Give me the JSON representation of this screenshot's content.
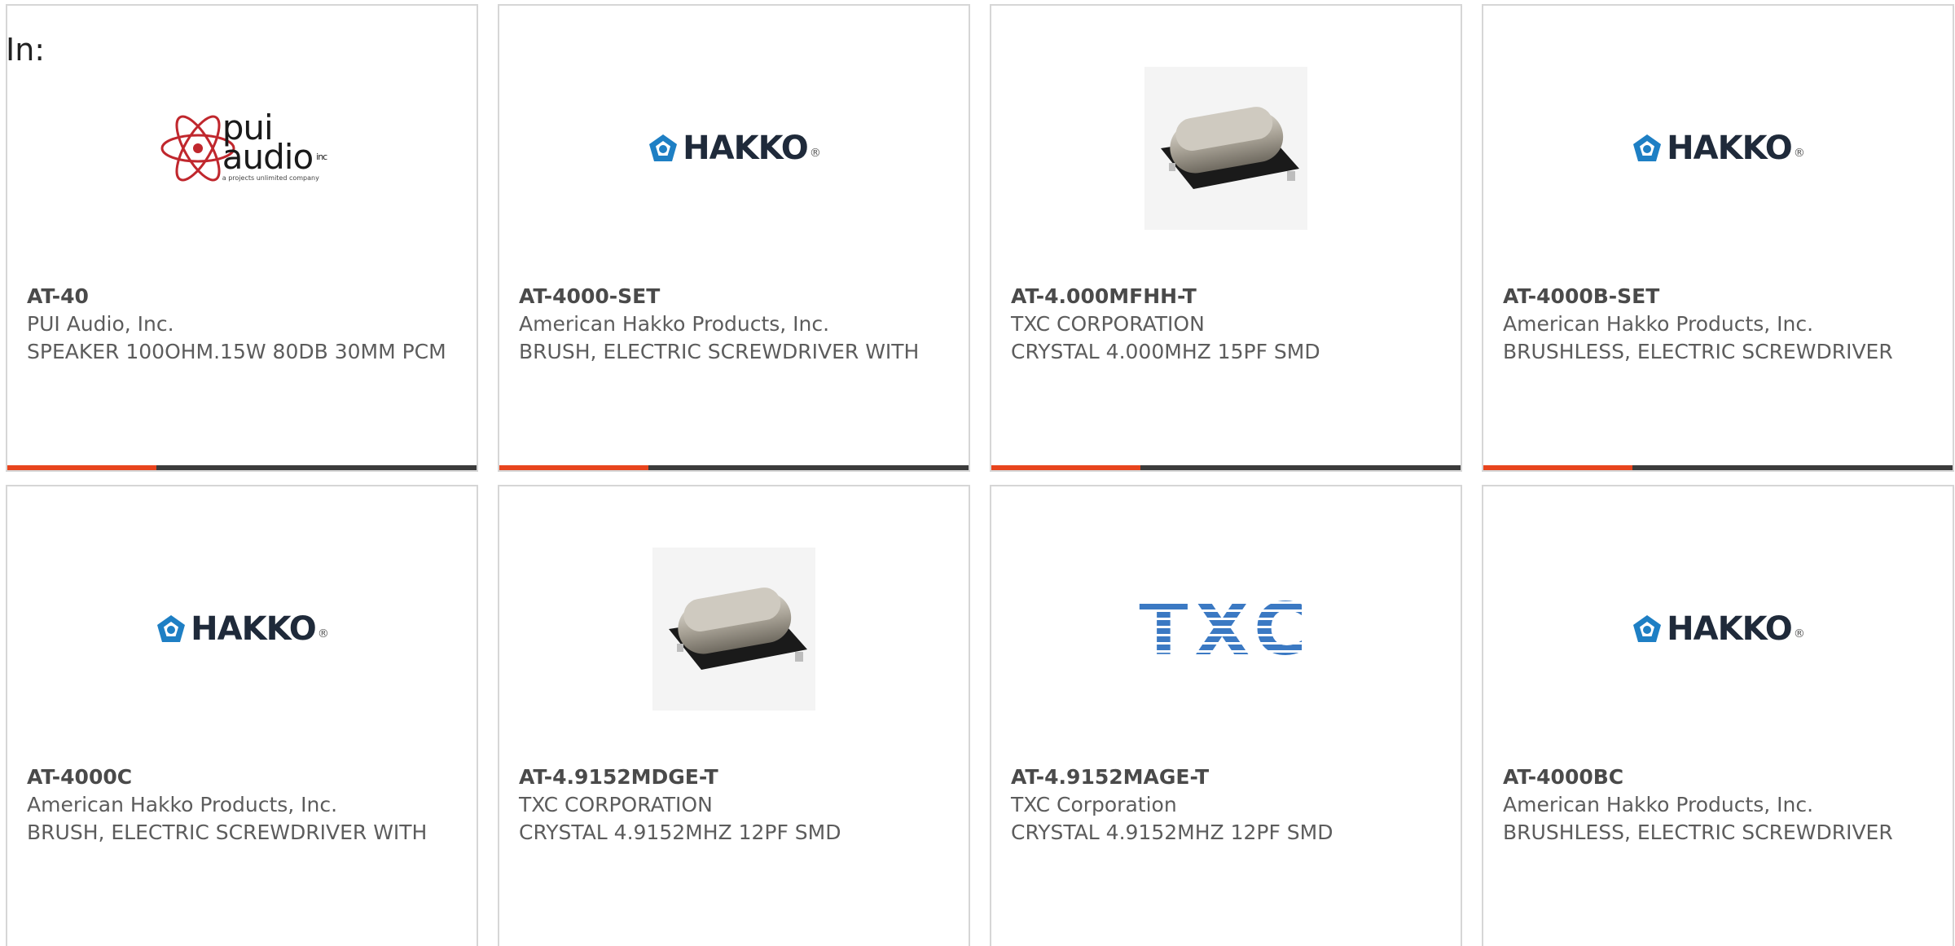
{
  "filter_label": "In:",
  "products": [
    {
      "part_number": "AT-40",
      "manufacturer": "PUI Audio, Inc.",
      "description": "SPEAKER 100OHM.15W 80DB 30MM PCM",
      "image": "pui-audio-logo"
    },
    {
      "part_number": "AT-4000-SET",
      "manufacturer": "American Hakko Products, Inc.",
      "description": "BRUSH, ELECTRIC SCREWDRIVER WITH",
      "image": "hakko-logo"
    },
    {
      "part_number": "AT-4.000MFHH-T",
      "manufacturer": "TXC CORPORATION",
      "description": "CRYSTAL 4.000MHZ 15PF SMD",
      "image": "crystal-smd-photo"
    },
    {
      "part_number": "AT-4000B-SET",
      "manufacturer": "American Hakko Products, Inc.",
      "description": "BRUSHLESS, ELECTRIC SCREWDRIVER",
      "image": "hakko-logo"
    },
    {
      "part_number": "AT-4000C",
      "manufacturer": "American Hakko Products, Inc.",
      "description": "BRUSH, ELECTRIC SCREWDRIVER WITH",
      "image": "hakko-logo"
    },
    {
      "part_number": "AT-4.9152MDGE-T",
      "manufacturer": "TXC CORPORATION",
      "description": "CRYSTAL 4.9152MHZ 12PF SMD",
      "image": "crystal-smd-photo"
    },
    {
      "part_number": "AT-4.9152MAGE-T",
      "manufacturer": "TXC Corporation",
      "description": "CRYSTAL 4.9152MHZ 12PF SMD",
      "image": "txc-logo"
    },
    {
      "part_number": "AT-4000BC",
      "manufacturer": "American Hakko Products, Inc.",
      "description": "BRUSHLESS, ELECTRIC SCREWDRIVER",
      "image": "hakko-logo"
    }
  ],
  "logos": {
    "pui_line1": "pui",
    "pui_line2": "audio",
    "pui_inc": "inc",
    "pui_tagline": "a projects unlimited company",
    "hakko": "HAKKO",
    "hakko_reg": "®",
    "txc": "TXC"
  },
  "colors": {
    "accent": "#e8441d",
    "bar": "#3b3b3b",
    "border": "#d6d6d6",
    "hakko_blue": "#1e7fc4",
    "txc_blue": "#3b79c3",
    "pui_red": "#c0272d"
  }
}
